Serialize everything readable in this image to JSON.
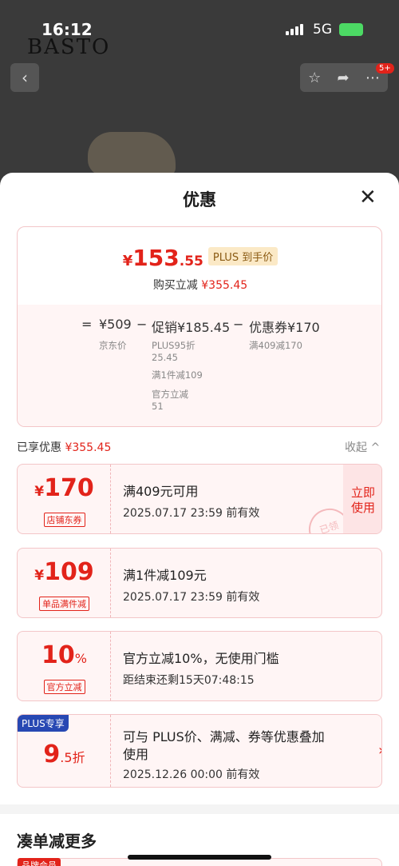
{
  "status": {
    "time": "16:12",
    "network": "5G"
  },
  "brand": "BASTO",
  "nav": {
    "badge": "5+"
  },
  "sheet": {
    "title": "优惠",
    "summary": {
      "price_yen": "¥",
      "price_int": "153",
      "price_dec": ".55",
      "plus_tag": "PLUS 到手价",
      "reduce_label": "购买立减",
      "reduce_value": "¥355.45",
      "formula": {
        "eq": "=",
        "base_price": "¥509",
        "base_label": "京东价",
        "minus1": "−",
        "promo": "促销¥185.45",
        "promo_notes": [
          "PLUS95折",
          "25.45",
          "满1件减109",
          "官方立减",
          "51"
        ],
        "minus2": "−",
        "coupon": "优惠券¥170",
        "coupon_note": "满409减170"
      }
    },
    "enjoyed_label": "已享优惠",
    "enjoyed_value": "¥355.45",
    "collapse_label": "收起 ^",
    "coupons": [
      {
        "yen": "¥",
        "num": "170",
        "unit": "",
        "tag": "店铺东券",
        "line1": "满409元可用",
        "line2": "2025.07.17 23:59 前有效",
        "button": "立即使用",
        "stamp": "已领"
      },
      {
        "yen": "¥",
        "num": "109",
        "unit": "",
        "tag": "单品满件减",
        "line1": "满1件减109元",
        "line2": "2025.07.17 23:59 前有效"
      },
      {
        "yen": "",
        "num": "10",
        "unit": "%",
        "tag": "官方立减",
        "line1": "官方立减10%，无使用门槛",
        "line2": "距结束还剩15天07:48:15"
      },
      {
        "plus_tag": "PLUS专享",
        "num": "9",
        "unit": ".5折",
        "line1a": "可与 PLUS价、满减、券等优惠叠加",
        "line1b": "使用",
        "line2": "2025.12.26 00:00 前有效"
      }
    ],
    "more_title": "凑单减更多",
    "next_tag": "品牌会员"
  }
}
